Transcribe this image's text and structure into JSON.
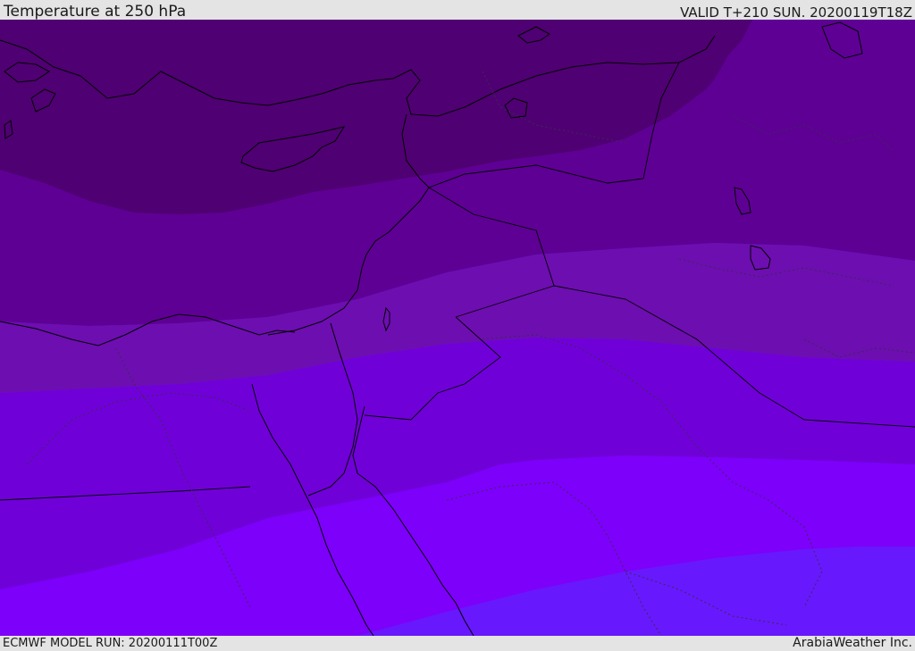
{
  "header": {
    "title": "Temperature at 250 hPa",
    "valid": "VALID T+210 SUN. 20200119T18Z"
  },
  "footer": {
    "model_run": "ECMWF MODEL RUN: 20200111T00Z",
    "credit": "ArabiaWeather Inc."
  },
  "map": {
    "bands": [
      {
        "id": "band-1",
        "color": "#4f0072"
      },
      {
        "id": "band-2",
        "color": "#5e0094"
      },
      {
        "id": "band-3",
        "color": "#6d0eb0"
      },
      {
        "id": "band-4",
        "color": "#7000d8"
      },
      {
        "id": "band-5",
        "color": "#7d00fa"
      },
      {
        "id": "band-6",
        "color": "#6818fc"
      }
    ],
    "coastline_color": "#000000",
    "border_color": "#3a2a55"
  }
}
